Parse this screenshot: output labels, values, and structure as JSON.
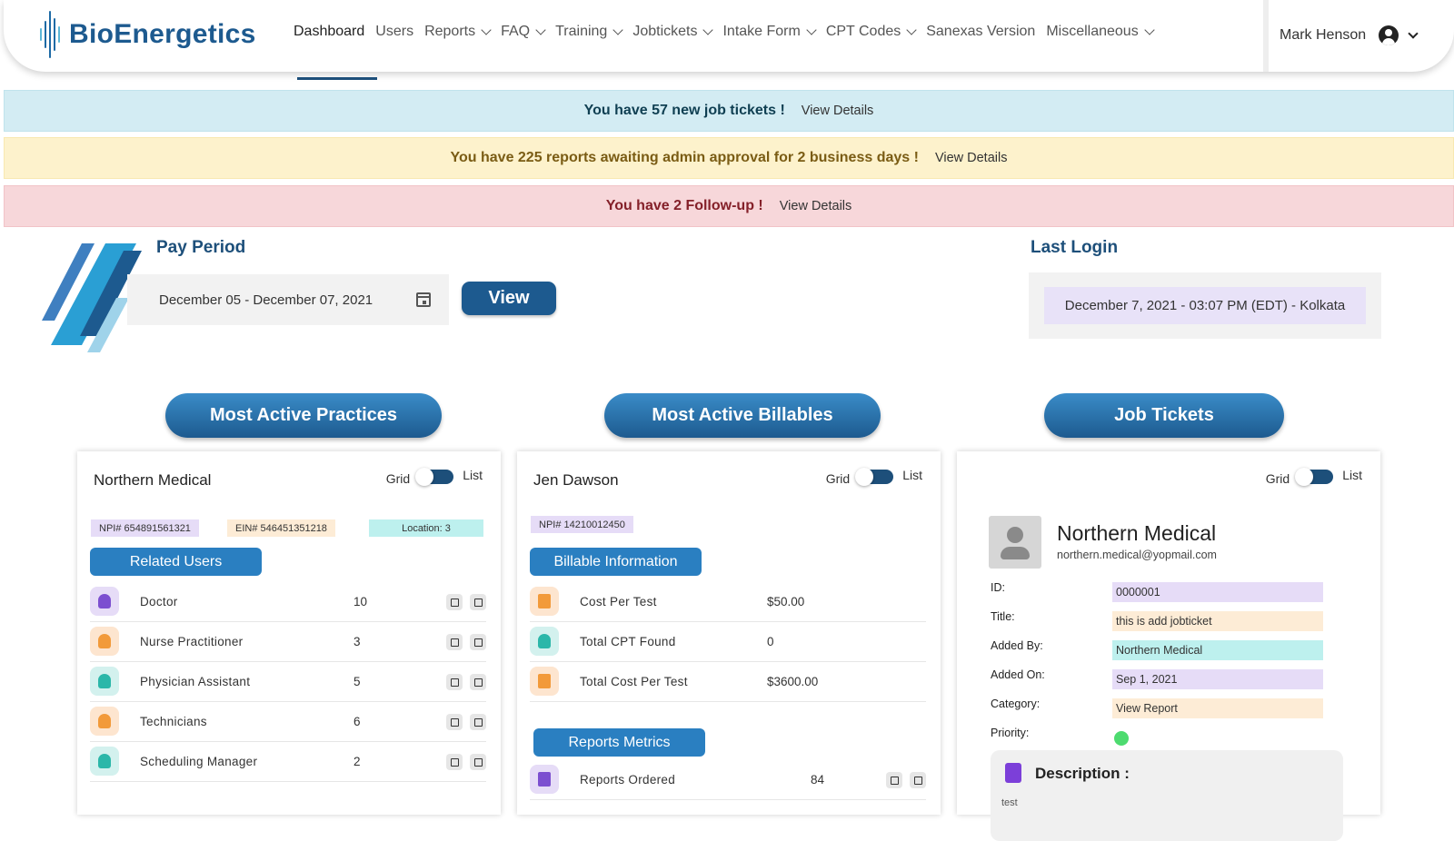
{
  "brand": {
    "name": "BioEnergetics"
  },
  "nav": {
    "items": [
      {
        "label": "Dashboard",
        "dropdown": false,
        "active": true
      },
      {
        "label": "Users",
        "dropdown": false
      },
      {
        "label": "Reports",
        "dropdown": true
      },
      {
        "label": "FAQ",
        "dropdown": true
      },
      {
        "label": "Training",
        "dropdown": true
      },
      {
        "label": "Jobtickets",
        "dropdown": true
      },
      {
        "label": "Intake Form",
        "dropdown": true
      },
      {
        "label": "CPT Codes",
        "dropdown": true
      },
      {
        "label": "Sanexas Version",
        "dropdown": false
      },
      {
        "label": "Miscellaneous",
        "dropdown": true
      }
    ],
    "user_name": "Mark Henson"
  },
  "alerts": {
    "job_tickets": {
      "message": "You have 57 new job tickets !",
      "link": "View Details"
    },
    "reports": {
      "message": "You have 225 reports awaiting admin approval for 2 business days !",
      "link": "View Details"
    },
    "followup": {
      "message": "You have 2 Follow-up !",
      "link": "View Details"
    }
  },
  "pay_period": {
    "title": "Pay Period",
    "date_range": "December 05 - December 07, 2021",
    "view_label": "View"
  },
  "last_login": {
    "title": "Last Login",
    "value": "December 7, 2021 - 03:07 PM (EDT) - Kolkata"
  },
  "sections": {
    "practices": "Most Active Practices",
    "billables": "Most Active Billables",
    "job_tickets": "Job Tickets"
  },
  "toggle": {
    "grid": "Grid",
    "list": "List"
  },
  "practice_card": {
    "name": "Northern Medical",
    "npi": "NPI# 654891561321",
    "ein": "EIN# 546451351218",
    "location": "Location: 3",
    "related_users_label": "Related Users",
    "rows": [
      {
        "label": "Doctor",
        "value": "10",
        "icon": "doctor-icon",
        "color": "#e6dcf7",
        "glyph": "#7c4fd0"
      },
      {
        "label": "Nurse Practitioner",
        "value": "3",
        "icon": "nurse-icon",
        "color": "#fde5cf",
        "glyph": "#f29a3a"
      },
      {
        "label": "Physician Assistant",
        "value": "5",
        "icon": "physician-icon",
        "color": "#d3f1ee",
        "glyph": "#2bb7a9"
      },
      {
        "label": "Technicians",
        "value": "6",
        "icon": "technician-icon",
        "color": "#fde5cf",
        "glyph": "#f29a3a"
      },
      {
        "label": "Scheduling Manager",
        "value": "2",
        "icon": "scheduler-icon",
        "color": "#d3f1ee",
        "glyph": "#2bb7a9"
      }
    ]
  },
  "billable_card": {
    "name": "Jen Dawson",
    "npi": "NPI# 14210012450",
    "billable_info_label": "Billable Information",
    "rows": [
      {
        "label": "Cost Per Test",
        "value": "$50.00",
        "icon": "document-icon",
        "color": "#fde5cf",
        "glyph": "#f29a3a"
      },
      {
        "label": "Total CPT Found",
        "value": "0",
        "icon": "user-icon",
        "color": "#d3f1ee",
        "glyph": "#2bb7a9"
      },
      {
        "label": "Total Cost Per Test",
        "value": "$3600.00",
        "icon": "document-icon",
        "color": "#fde5cf",
        "glyph": "#f29a3a"
      }
    ],
    "reports_metrics_label": "Reports Metrics",
    "metrics_rows": [
      {
        "label": "Reports Ordered",
        "value": "84",
        "icon": "report-icon",
        "color": "#e6dcf7",
        "glyph": "#7c4fd0"
      }
    ]
  },
  "ticket_card": {
    "name": "Northern Medical",
    "email": "northern.medical@yopmail.com",
    "fields": [
      {
        "label": "ID:",
        "value": "0000001",
        "color": "#e6dcf7"
      },
      {
        "label": "Title:",
        "value": "this is add jobticket",
        "color": "#fdecd6"
      },
      {
        "label": "Added By:",
        "value": "Northern Medical",
        "color": "#bdf0ee"
      },
      {
        "label": "Added On:",
        "value": "Sep 1, 2021",
        "color": "#e6dcf7"
      },
      {
        "label": "Category:",
        "value": "View Report",
        "color": "#fdecd6"
      }
    ],
    "priority_label": "Priority:",
    "priority_color": "#4ddb6f",
    "description_label": "Description :",
    "description_text": "test"
  },
  "colors": {
    "brand": "#1d5a8f",
    "accent": "#2a7fc1"
  }
}
